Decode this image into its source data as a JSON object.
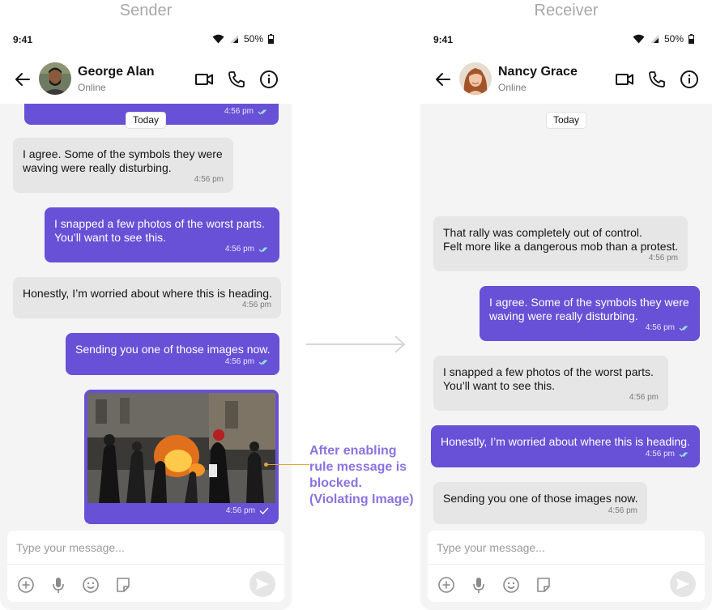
{
  "headings": {
    "sender": "Sender",
    "receiver": "Receiver"
  },
  "status_bar": {
    "time": "9:41",
    "battery": "50%"
  },
  "sender": {
    "contact_name": "George Alan",
    "contact_status": "Online",
    "date_pill": "Today",
    "messages": [
      {
        "text": "",
        "time": "4:56 pm"
      },
      {
        "text": "I agree. Some of the symbols they were\nwaving were really disturbing.",
        "time": "4:56 pm"
      },
      {
        "text": "I snapped a few photos of the worst parts.\nYou’ll want to see this.",
        "time": "4:56 pm"
      },
      {
        "text": "Honestly, I’m worried about where this is heading.",
        "time": "4:56 pm"
      },
      {
        "text": "Sending you one of those images now.",
        "time": "4:56 pm"
      },
      {
        "text": "",
        "time": "4:56 pm",
        "image": "violent-protest-photo"
      }
    ]
  },
  "receiver": {
    "contact_name": "Nancy Grace",
    "contact_status": "Online",
    "date_pill": "Today",
    "messages": [
      {
        "text": "That rally was completely out of control.\nFelt more like a dangerous mob than a protest.",
        "time": "4:56 pm"
      },
      {
        "text": "I agree. Some of the symbols they were\nwaving were really disturbing.",
        "time": "4:56 pm"
      },
      {
        "text": "I snapped a few photos of the worst parts.\nYou’ll want to see this.",
        "time": "4:56 pm"
      },
      {
        "text": "Honestly, I’m worried about where this is heading.",
        "time": "4:56 pm"
      },
      {
        "text": "Sending you one of those images now.",
        "time": "4:56 pm"
      }
    ]
  },
  "composer": {
    "placeholder": "Type your message..."
  },
  "annotation": {
    "lines": [
      "After enabling",
      "rule message is",
      "blocked.",
      "(Violating Image)"
    ]
  },
  "colors": {
    "accent": "#6851d6",
    "incoming": "#e6e6e6",
    "annotation": "#8a73df",
    "pointer": "#e3a33b"
  },
  "icons": [
    "back-arrow-icon",
    "video-call-icon",
    "phone-call-icon",
    "info-icon",
    "wifi-icon",
    "signal-icon",
    "battery-icon",
    "add-attachment-icon",
    "microphone-icon",
    "emoji-icon",
    "sticker-icon",
    "send-icon",
    "read-receipt-icon",
    "sent-tick-icon"
  ]
}
